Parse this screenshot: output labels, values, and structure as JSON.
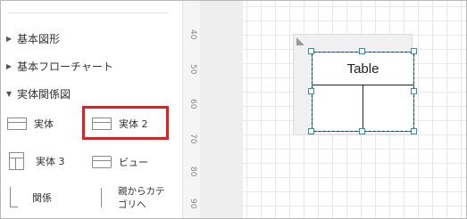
{
  "library": {
    "sections": [
      {
        "label": "基本図形",
        "expanded": false
      },
      {
        "label": "基本フローチャート",
        "expanded": false
      },
      {
        "label": "実体関係図",
        "expanded": true
      }
    ],
    "items": [
      {
        "label": "実体",
        "icon": "entity-icon"
      },
      {
        "label": "実体 2",
        "icon": "entity2-icon",
        "highlighted": true
      },
      {
        "label": "実体 3",
        "icon": "entity3-icon"
      },
      {
        "label": "ビュー",
        "icon": "view-icon"
      },
      {
        "label": "関係",
        "icon": "relation-icon"
      },
      {
        "label": "親からカテゴリへ",
        "icon": "parent-category-icon"
      }
    ],
    "highlight_color": "#e02020"
  },
  "ruler": {
    "ticks": [
      "40",
      "50",
      "60",
      "70",
      "80",
      "90"
    ]
  },
  "canvas": {
    "entity": {
      "title": "Table"
    },
    "selection_color": "#2f8fb8"
  }
}
